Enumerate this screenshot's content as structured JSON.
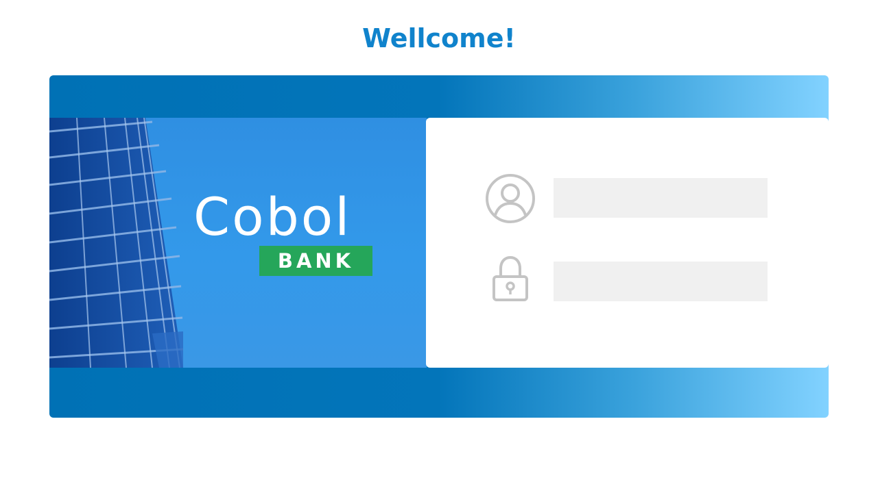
{
  "page": {
    "title": "Wellcome!"
  },
  "brand": {
    "name": "Cobol",
    "badge": "BANK",
    "badge_color": "#25a65a",
    "accent_color": "#1083cc"
  },
  "login": {
    "username": {
      "icon": "user-circle-icon",
      "value": "",
      "placeholder": ""
    },
    "password": {
      "icon": "lock-icon",
      "value": "",
      "placeholder": ""
    }
  }
}
